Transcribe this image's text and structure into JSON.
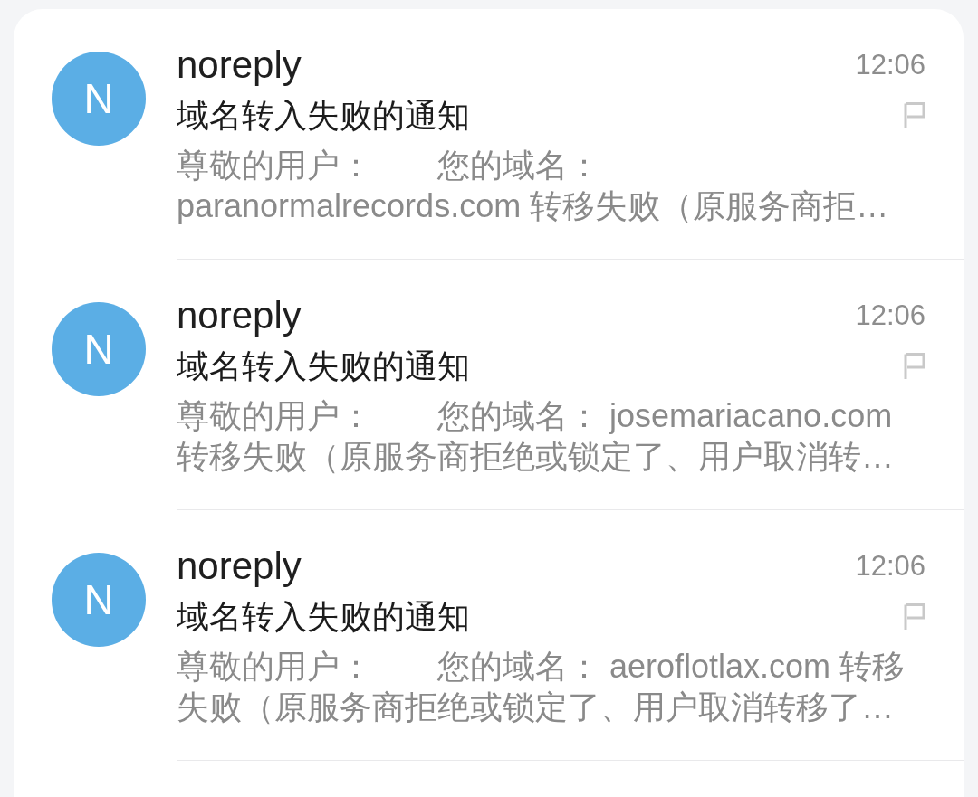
{
  "emails": [
    {
      "avatar": "N",
      "sender": "noreply",
      "time": "12:06",
      "subject": "域名转入失败的通知",
      "flagged": false,
      "preview": "尊敬的用户：　　您的域名： paranormalrecords.com 转移失败（原服务商拒…"
    },
    {
      "avatar": "N",
      "sender": "noreply",
      "time": "12:06",
      "subject": "域名转入失败的通知",
      "flagged": false,
      "preview": "尊敬的用户：　　您的域名： josemariacano.com 转移失败（原服务商拒绝或锁定了、用户取消转…"
    },
    {
      "avatar": "N",
      "sender": "noreply",
      "time": "12:06",
      "subject": "域名转入失败的通知",
      "flagged": false,
      "preview": "尊敬的用户：　　您的域名： aeroflotlax.com 转移失败（原服务商拒绝或锁定了、用户取消转移了…"
    }
  ]
}
